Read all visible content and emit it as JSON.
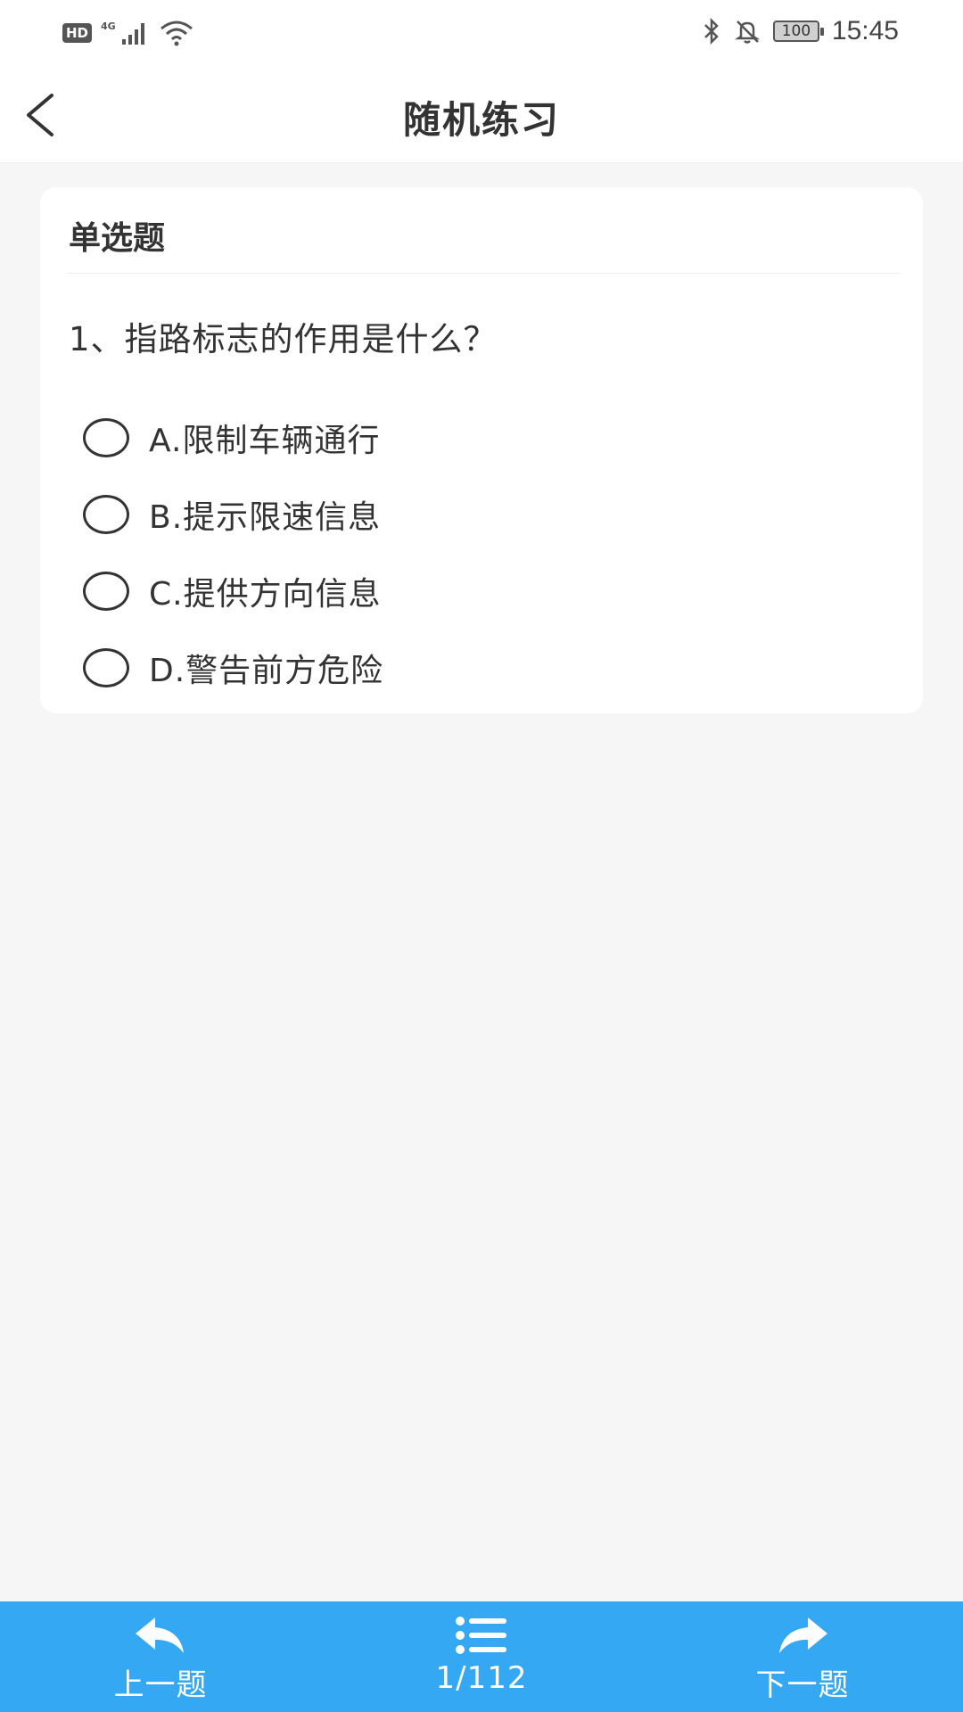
{
  "status_bar": {
    "hd": "HD",
    "network": "4G",
    "battery": "100",
    "time": "15:45",
    "icons": [
      "signal-icon",
      "wifi-icon",
      "bluetooth-icon",
      "mute-icon",
      "battery-icon"
    ]
  },
  "header": {
    "title": "随机练习",
    "back_icon": "chevron-left-icon"
  },
  "question": {
    "type": "单选题",
    "text": "1、指路标志的作用是什么？",
    "options": [
      {
        "label": "A.限制车辆通行"
      },
      {
        "label": "B.提示限速信息"
      },
      {
        "label": "C.提供方向信息"
      },
      {
        "label": "D.警告前方危险"
      }
    ]
  },
  "bottom_bar": {
    "prev_label": "上一题",
    "progress": "1/112",
    "next_label": "下一题",
    "color": "#34a8f2"
  }
}
